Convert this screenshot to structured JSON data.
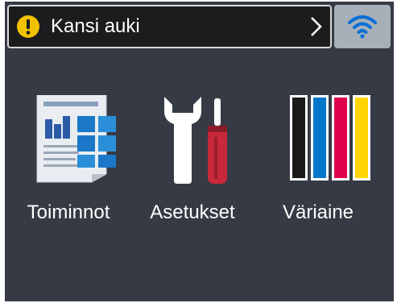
{
  "status_bar": {
    "message": "Kansi auki",
    "alert_icon": "warning-icon",
    "alert_color": "#f2c200",
    "chevron_icon": "chevron-right-icon"
  },
  "wifi": {
    "icon": "wifi-icon",
    "icon_color": "#0a6fd6"
  },
  "menu": {
    "items": [
      {
        "label": "Toiminnot",
        "icon": "functions-icon"
      },
      {
        "label": "Asetukset",
        "icon": "settings-tools-icon"
      },
      {
        "label": "Väriaine",
        "icon": "toner-icon"
      }
    ]
  },
  "colors": {
    "screen_background": "#353a44",
    "toner": [
      "#1a1a1a",
      "#0077c8",
      "#e0004d",
      "#ffd400"
    ]
  }
}
